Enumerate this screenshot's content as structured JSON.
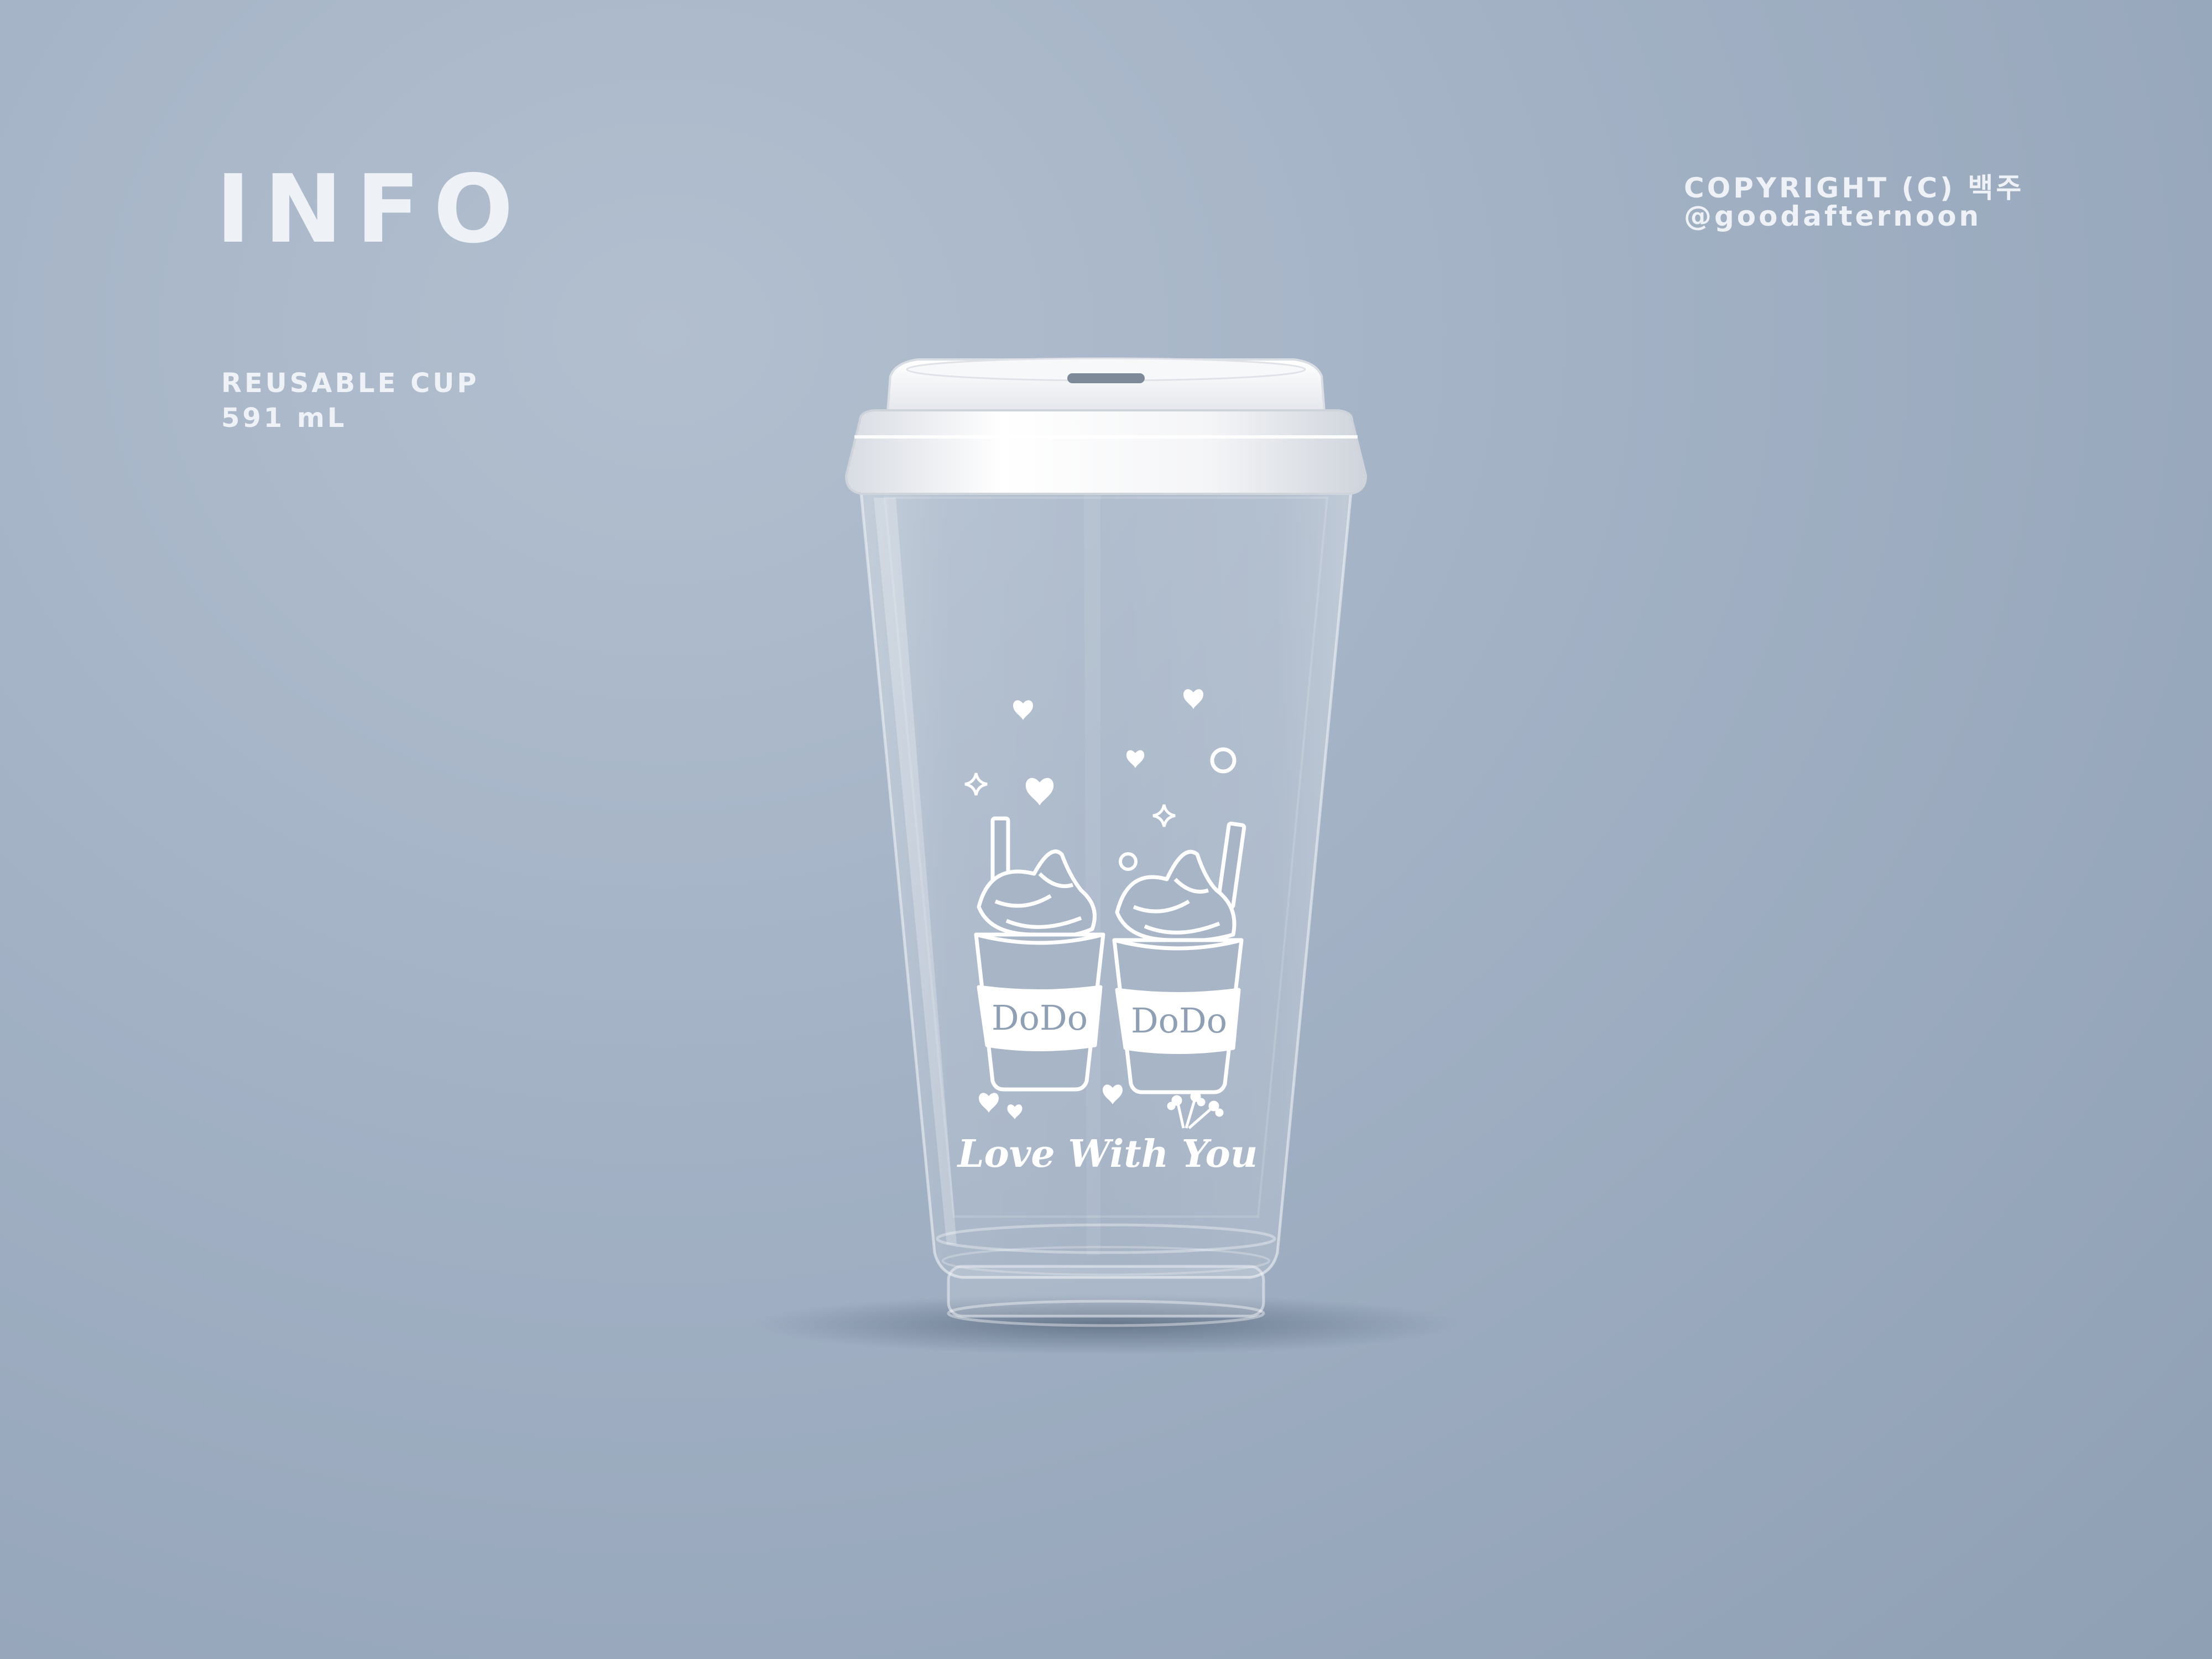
{
  "header": {
    "title": "INFO",
    "copyright": "COPYRIGHT (C) 백주",
    "handle": "@goodafternoon"
  },
  "product": {
    "name": "REUSABLE CUP",
    "volume": "591 mL"
  },
  "cup_print": {
    "brand_left": "DoDo",
    "brand_right": "DoDo",
    "tagline": "Love With You"
  },
  "icons": [
    "heart-icon",
    "sparkle-icon",
    "circle-icon",
    "flower-icon"
  ],
  "colors": {
    "background": "#a3b2c5",
    "text": "#eef1f5",
    "lid": "#f3f4f6",
    "print": "#ffffff"
  }
}
